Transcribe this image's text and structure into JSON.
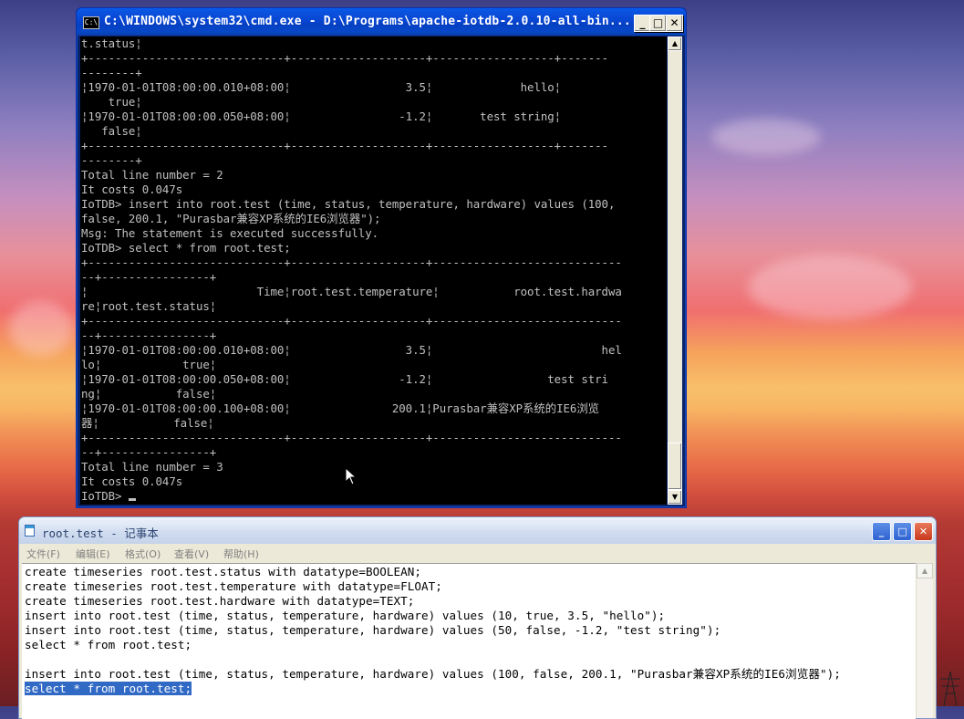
{
  "cmd": {
    "title": "C:\\WINDOWS\\system32\\cmd.exe - D:\\Programs\\apache-iotdb-2.0.10-all-bin...",
    "sys_icon": "C:\\",
    "min_glyph": "_",
    "max_glyph": "□",
    "close_glyph": "✕",
    "lines": [
      "t.status¦",
      "+-----------------------------+--------------------+------------------+-------",
      "--------+",
      "¦1970-01-01T08:00:00.010+08:00¦                 3.5¦             hello¦",
      "    true¦",
      "¦1970-01-01T08:00:00.050+08:00¦                -1.2¦       test string¦",
      "   false¦",
      "+-----------------------------+--------------------+------------------+-------",
      "--------+",
      "Total line number = 2",
      "It costs 0.047s",
      "IoTDB> insert into root.test (time, status, temperature, hardware) values (100,",
      "false, 200.1, \"Purasbar兼容XP系统的IE6浏览器\");",
      "Msg: The statement is executed successfully.",
      "IoTDB> select * from root.test;",
      "+-----------------------------+--------------------+----------------------------",
      "--+----------------+",
      "¦                         Time¦root.test.temperature¦           root.test.hardwa",
      "re¦root.test.status¦",
      "+-----------------------------+--------------------+----------------------------",
      "--+----------------+",
      "¦1970-01-01T08:00:00.010+08:00¦                 3.5¦                         hel",
      "lo¦            true¦",
      "¦1970-01-01T08:00:00.050+08:00¦                -1.2¦                 test stri",
      "ng¦           false¦",
      "¦1970-01-01T08:00:00.100+08:00¦               200.1¦Purasbar兼容XP系统的IE6浏览",
      "器¦           false¦",
      "+-----------------------------+--------------------+----------------------------",
      "--+----------------+",
      "Total line number = 3",
      "It costs 0.047s"
    ],
    "prompt": "IoTDB> "
  },
  "notepad": {
    "title": "root.test - 记事本",
    "min_glyph": "_",
    "max_glyph": "□",
    "close_glyph": "✕",
    "menu": {
      "file": "文件(F)",
      "edit": "编辑(E)",
      "format": "格式(O)",
      "view": "查看(V)",
      "help": "帮助(H)"
    },
    "lines": [
      "create timeseries root.test.status with datatype=BOOLEAN;",
      "create timeseries root.test.temperature with datatype=FLOAT;",
      "create timeseries root.test.hardware with datatype=TEXT;",
      "insert into root.test (time, status, temperature, hardware) values (10, true, 3.5, \"hello\");",
      "insert into root.test (time, status, temperature, hardware) values (50, false, -1.2, \"test string\");",
      "select * from root.test;",
      "",
      "insert into root.test (time, status, temperature, hardware) values (100, false, 200.1, \"Purasbar兼容XP系统的IE6浏览器\");"
    ],
    "selected_line": "select * from root.test;"
  },
  "icons": {
    "console": "console-icon",
    "notepad": "notepad-icon",
    "mouse": "mouse-pointer-icon"
  },
  "colors": {
    "xp_title_blue": "#0846d2",
    "selection": "#316ac5",
    "console_text": "#c0c0c0"
  }
}
